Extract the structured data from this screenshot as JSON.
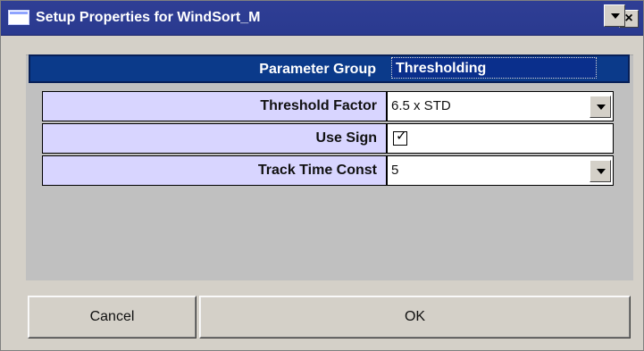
{
  "window": {
    "title": "Setup Properties for WindSort_M",
    "close_glyph": "×"
  },
  "parameter_group": {
    "label": "Parameter Group",
    "value": "Thresholding"
  },
  "properties": [
    {
      "label": "Threshold Factor",
      "value": "6.5 x STD",
      "type": "dropdown"
    },
    {
      "label": "Use Sign",
      "value": "checked",
      "type": "checkbox"
    },
    {
      "label": "Track Time Const",
      "value": "5",
      "type": "dropdown"
    }
  ],
  "buttons": {
    "cancel": "Cancel",
    "ok": "OK"
  },
  "icons": {
    "window": "window-icon",
    "close": "close-icon",
    "dropdown": "chevron-down-icon",
    "check": "check-icon"
  },
  "colors": {
    "titlebar": "#2f3e95",
    "parameter_group": "#0b3a8a",
    "label_cells": "#d8d5ff",
    "panel": "#c0c0c0",
    "window_bg": "#d4d0c8"
  }
}
